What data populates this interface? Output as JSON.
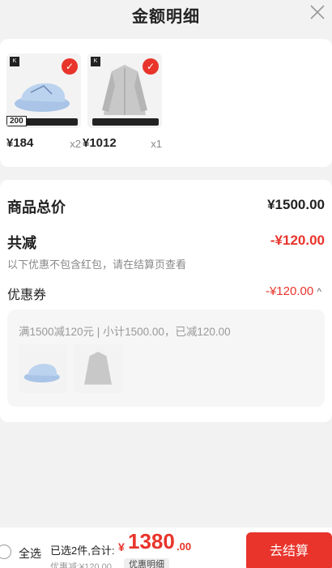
{
  "header": {
    "title": "金额明细"
  },
  "products": [
    {
      "brand": "K",
      "count_tag": "200",
      "price": "¥184",
      "qty": "x2"
    },
    {
      "brand": "K",
      "price": "¥1012",
      "qty": "x1"
    }
  ],
  "summary": {
    "goods_total_label": "商品总价",
    "goods_total_value": "¥1500.00",
    "discount_label": "共减",
    "discount_value": "-¥120.00",
    "discount_note": "以下优惠不包含红包，请在结算页查看",
    "coupon_label": "优惠券",
    "coupon_value": "-¥120.00",
    "coupon_chevron": "^",
    "coupon_desc": "满1500减120元 | 小计1500.00，已减120.00"
  },
  "bottom": {
    "select_all": "全选",
    "selected_info": "已选2件,合计:",
    "total_symbol": "¥",
    "total_int": "1380",
    "total_dec": ".00",
    "discount_note": "优惠减:¥120.00",
    "detail_button": "优惠明细",
    "checkout_button": "去结算"
  },
  "colors": {
    "accent": "#e8342b"
  }
}
